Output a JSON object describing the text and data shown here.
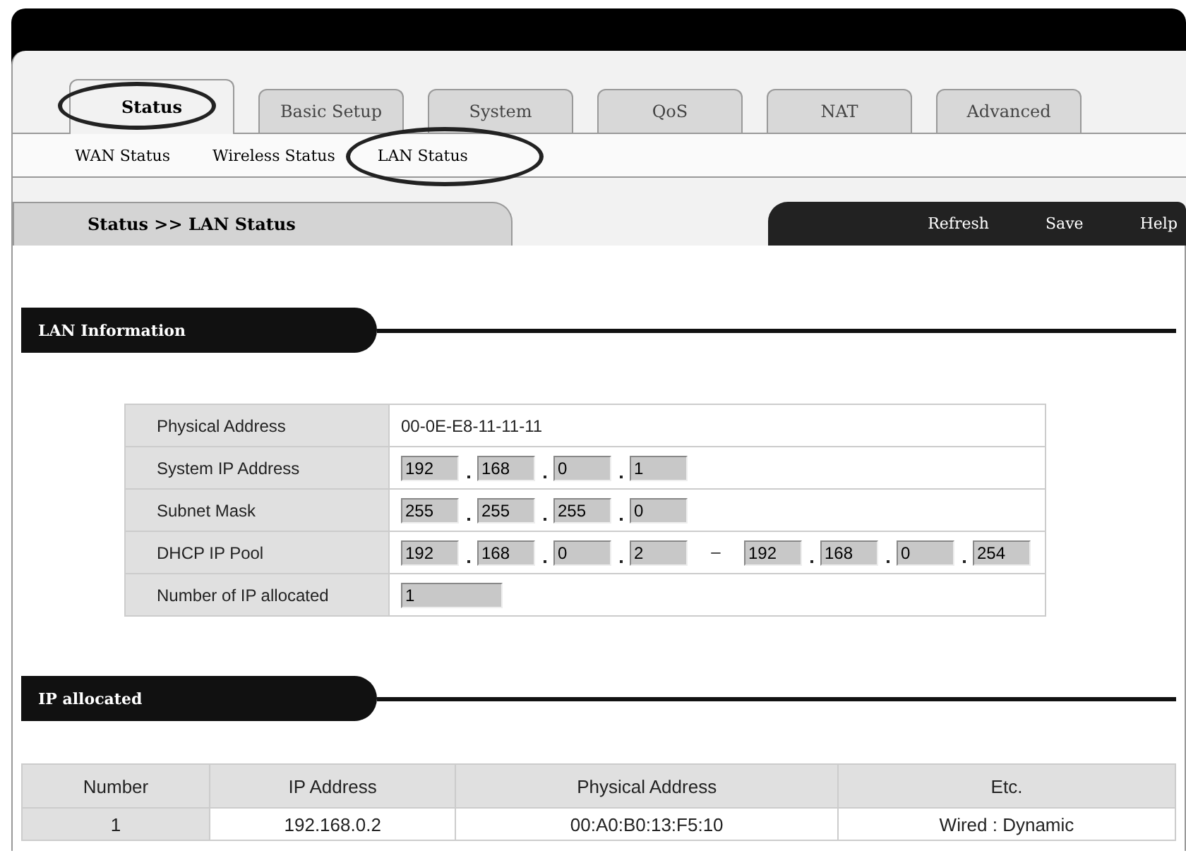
{
  "tabs": [
    {
      "label": "Status",
      "selected": true
    },
    {
      "label": "Basic Setup",
      "selected": false
    },
    {
      "label": "System",
      "selected": false
    },
    {
      "label": "QoS",
      "selected": false
    },
    {
      "label": "NAT",
      "selected": false
    },
    {
      "label": "Advanced",
      "selected": false
    }
  ],
  "subtabs": [
    {
      "label": "WAN Status",
      "selected": false
    },
    {
      "label": "Wireless Status",
      "selected": false
    },
    {
      "label": "LAN Status",
      "selected": true
    }
  ],
  "breadcrumb": "Status >> LAN Status",
  "actions": [
    "Refresh",
    "Save",
    "Help"
  ],
  "lan_information": {
    "title": "LAN Information",
    "rows": [
      {
        "label": "Physical Address",
        "kind": "text",
        "value": "00-0E-E8-11-11-11"
      },
      {
        "label": "System IP Address",
        "kind": "ip",
        "octets": [
          "192",
          "168",
          "0",
          "1"
        ]
      },
      {
        "label": "Subnet Mask",
        "kind": "ip",
        "octets": [
          "255",
          "255",
          "255",
          "0"
        ]
      },
      {
        "label": "DHCP IP Pool",
        "kind": "range",
        "octets": [
          "192",
          "168",
          "0",
          "2"
        ],
        "separator": "–",
        "end_octets": [
          "192",
          "168",
          "0",
          "254"
        ]
      },
      {
        "label": "Number of IP allocated",
        "kind": "field",
        "value": "1"
      }
    ]
  },
  "ip_allocated": {
    "title": "IP allocated",
    "columns": [
      "Number",
      "IP Address",
      "Physical Address",
      "Etc."
    ],
    "rows": [
      [
        "1",
        "192.168.0.2",
        "00:A0:B0:13:F5:10",
        "Wired : Dynamic"
      ]
    ]
  }
}
